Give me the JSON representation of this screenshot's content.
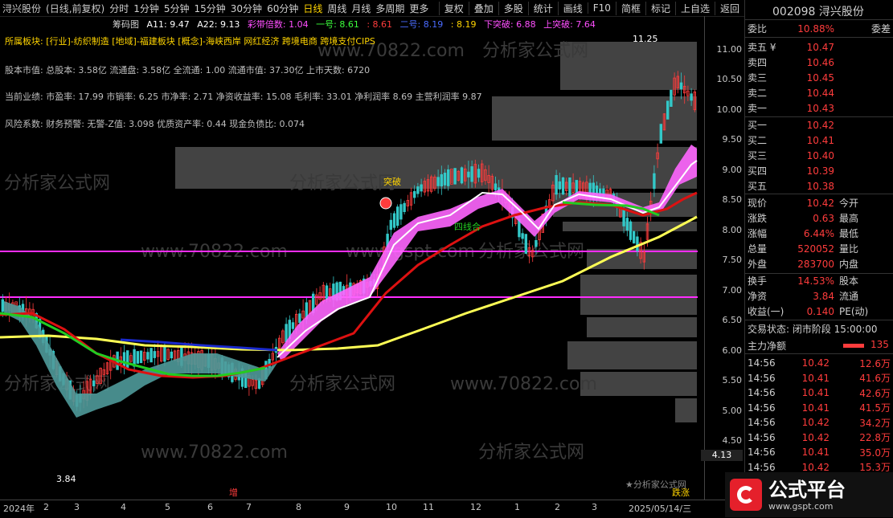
{
  "toolbar": {
    "stock_label": "浔兴股份",
    "stock_mode": "(日线,前复权)",
    "periods": [
      "分时",
      "1分钟",
      "5分钟",
      "15分钟",
      "30分钟",
      "60分钟",
      "日线",
      "周线",
      "月线",
      "多周期",
      "更多"
    ],
    "active_period": "日线",
    "indicator_name": "筹码图",
    "a11": "A11: 9.47",
    "a22": "A22: 9.13",
    "cdbs": "彩带倍数: 1.04",
    "yihao": "一号: 8.61",
    "v3": ": 8.61",
    "erhao": "二号: 8.19",
    "v5": ": 8.19",
    "xiatupo": "下突破: 6.88",
    "shangtupo": "上突破: 7.64",
    "buttons": [
      "复权",
      "叠加",
      "多股",
      "统计",
      "画线",
      "F10",
      "简框",
      "标记",
      "上自选",
      "返回"
    ]
  },
  "info": {
    "sector_line": "所属板块: [行业]-纺织制造 [地域]-福建板块 [概念]-海峡西岸 网红经济 跨境电商 跨境支付CIPS",
    "equity_line": "股本市值: 总股本: 3.58亿 流通盘: 3.58亿 全流通: 1.00 流通市值: 37.30亿 上市天数: 6720",
    "perf_line": "当前业绩: 市盈率: 17.99 市销率: 6.25 市净率: 2.71 净资收益率: 15.08 毛利率: 33.01 净利润率 8.69 主营利润率 9.87",
    "risk_line": "风险系数: 财务预警: 无警-Z值: 3.098 优质资产率: 0.44 现金负债比: 0.074"
  },
  "chart_labels": {
    "high": "11.25",
    "low": "3.84",
    "tupo": "突破",
    "sixian": "四线合",
    "current": "4.13",
    "watermark": "★分析家公式网",
    "zeng": "增",
    "diezhang": "跌涨",
    "wm1": "分析家公式网",
    "wm2": "www.70822.com",
    "wm3": "www.gspt.com"
  },
  "chart_data": {
    "type": "candlestick",
    "y_ticks": [
      "11.00",
      "10.50",
      "10.00",
      "9.50",
      "9.00",
      "8.50",
      "8.00",
      "7.50",
      "7.00",
      "6.50",
      "6.00",
      "5.50",
      "5.00",
      "4.50"
    ],
    "x_ticks": [
      "2024年",
      "2",
      "3",
      "4",
      "5",
      "6",
      "7",
      "8",
      "9",
      "10",
      "11",
      "12",
      "1",
      "2",
      "3",
      "2025/05/14/三"
    ],
    "ylim": [
      4.13,
      11.5
    ],
    "magenta_lines": [
      7.64,
      6.88
    ],
    "annotations": {
      "high": 11.25,
      "low": 3.84
    }
  },
  "panel": {
    "code_name": "002098 浔兴股份",
    "weibi_label": "委比",
    "weibi": "10.88%",
    "weicha_label": "委差",
    "weicha": "",
    "sells": [
      {
        "label": "卖五 ¥",
        "price": "10.47",
        "vol": ""
      },
      {
        "label": "卖四",
        "price": "10.46",
        "vol": ""
      },
      {
        "label": "卖三",
        "price": "10.45",
        "vol": ""
      },
      {
        "label": "卖二",
        "price": "10.44",
        "vol": ""
      },
      {
        "label": "卖一",
        "price": "10.43",
        "vol": ""
      }
    ],
    "buys": [
      {
        "label": "买一",
        "price": "10.42",
        "vol": ""
      },
      {
        "label": "买二",
        "price": "10.41",
        "vol": ""
      },
      {
        "label": "买三",
        "price": "10.40",
        "vol": ""
      },
      {
        "label": "买四",
        "price": "10.39",
        "vol": ""
      },
      {
        "label": "买五",
        "price": "10.38",
        "vol": ""
      }
    ],
    "stats": [
      {
        "l1": "现价",
        "v1": "10.42",
        "l2": "今开"
      },
      {
        "l1": "涨跌",
        "v1": "0.63",
        "l2": "最高"
      },
      {
        "l1": "涨幅",
        "v1": "6.44%",
        "l2": "最低"
      },
      {
        "l1": "总量",
        "v1": "520052",
        "l2": "量比"
      },
      {
        "l1": "外盘",
        "v1": "283700",
        "l2": "内盘"
      }
    ],
    "stats2": [
      {
        "l1": "换手",
        "v1": "14.53%",
        "l2": "股本"
      },
      {
        "l1": "净资",
        "v1": "3.84",
        "l2": "流通"
      },
      {
        "l1": "收益(一)",
        "v1": "0.140",
        "l2": "PE(动)"
      }
    ],
    "trade_status": "交易状态: 闭市阶段 15:00:00",
    "main_flow_label": "主力净额",
    "main_flow_value": "135",
    "ticks": [
      {
        "t": "14:56",
        "p": "10.42",
        "v": "12.6万"
      },
      {
        "t": "14:56",
        "p": "10.41",
        "v": "41.6万"
      },
      {
        "t": "14:56",
        "p": "10.41",
        "v": "42.6万"
      },
      {
        "t": "14:56",
        "p": "10.41",
        "v": "41.5万"
      },
      {
        "t": "14:56",
        "p": "10.42",
        "v": "34.2万"
      },
      {
        "t": "14:56",
        "p": "10.42",
        "v": "22.8万"
      },
      {
        "t": "14:56",
        "p": "10.41",
        "v": "35.0万"
      },
      {
        "t": "14:56",
        "p": "10.42",
        "v": "15.3万"
      }
    ]
  },
  "logo": {
    "title": "公式平台",
    "url": "www.gspt.com"
  }
}
